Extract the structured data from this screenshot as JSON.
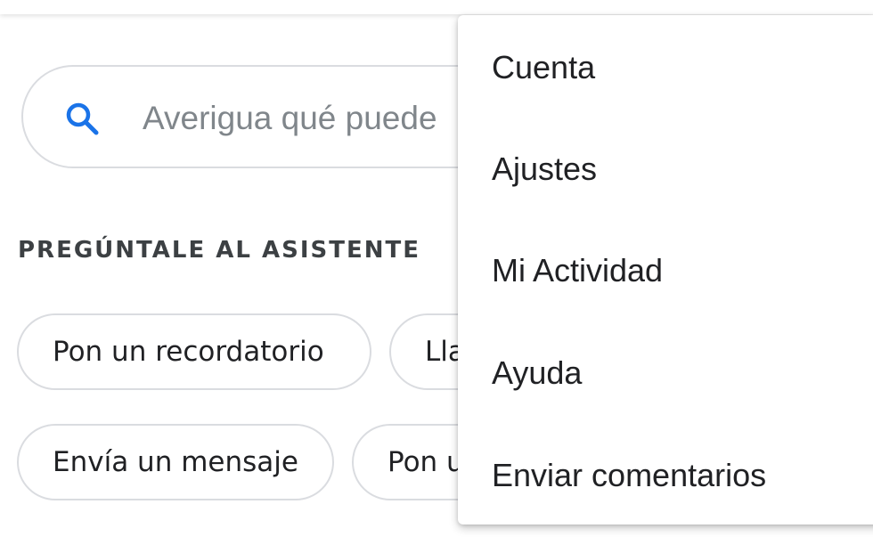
{
  "search": {
    "placeholder": "Averigua qué puede"
  },
  "suggestions": {
    "title": "PREGÚNTALE AL ASISTENTE",
    "chips": [
      "Pon un recordatorio",
      "Lla",
      "Envía un mensaje",
      "Pon u"
    ]
  },
  "menu": {
    "items": [
      "Cuenta",
      "Ajustes",
      "Mi Actividad",
      "Ayuda",
      "Enviar comentarios"
    ]
  },
  "colors": {
    "accent": "#1a73e8",
    "border": "#dadce0",
    "text": "#202124",
    "placeholder": "#80868b"
  },
  "icons": {
    "search": "search-icon"
  }
}
